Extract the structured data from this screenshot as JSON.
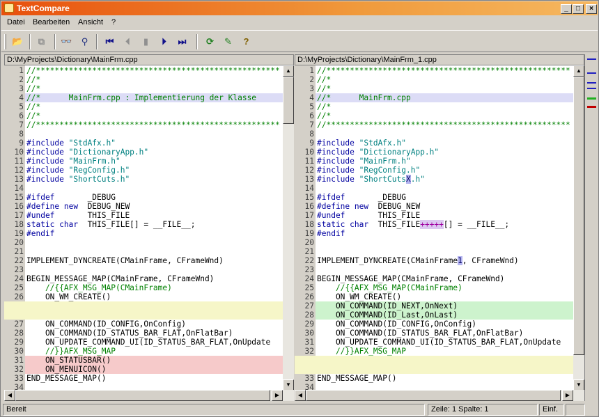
{
  "window": {
    "title": "TextCompare",
    "minimize_label": "_",
    "maximize_label": "□",
    "close_label": "×"
  },
  "menu": [
    {
      "label": "Datei"
    },
    {
      "label": "Bearbeiten"
    },
    {
      "label": "Ansicht"
    },
    {
      "label": "?"
    }
  ],
  "toolbar": [
    {
      "name": "open-folder-icon",
      "glyph": "📂"
    },
    {
      "name": "copy-icon",
      "glyph": "⧉"
    },
    {
      "name": "binoculars-icon",
      "glyph": "👓"
    },
    {
      "name": "find-next-icon",
      "glyph": "⚲"
    },
    {
      "name": "first-diff-icon",
      "glyph": "⏮"
    },
    {
      "name": "prev-diff-icon",
      "glyph": "⏴"
    },
    {
      "name": "current-diff-icon",
      "glyph": "▮"
    },
    {
      "name": "next-diff-icon",
      "glyph": "⏵"
    },
    {
      "name": "last-diff-icon",
      "glyph": "⏭"
    },
    {
      "name": "refresh-icon",
      "glyph": "⟳"
    },
    {
      "name": "options-icon",
      "glyph": "✎"
    },
    {
      "name": "help-icon",
      "glyph": "?"
    }
  ],
  "left": {
    "path": "D:\\MyProjects\\Dictionary\\MainFrm.cpp",
    "lines": [
      {
        "n": "1",
        "t": "//****************************************************",
        "c": "cm"
      },
      {
        "n": "2",
        "t": "//*",
        "c": "cm"
      },
      {
        "n": "3",
        "t": "//*",
        "c": "cm"
      },
      {
        "n": "4",
        "t": "//*      MainFrm.cpp : Implementierung der Klasse",
        "c": "cm",
        "hl": "mod"
      },
      {
        "n": "5",
        "t": "//*",
        "c": "cm"
      },
      {
        "n": "6",
        "t": "//*",
        "c": "cm"
      },
      {
        "n": "7",
        "t": "//****************************************************",
        "c": "cm"
      },
      {
        "n": "8",
        "t": "",
        "c": "def"
      },
      {
        "n": "9",
        "t": "#include \"StdAfx.h\"",
        "c": "inc"
      },
      {
        "n": "10",
        "t": "#include \"DictionaryApp.h\"",
        "c": "inc"
      },
      {
        "n": "11",
        "t": "#include \"MainFrm.h\"",
        "c": "inc"
      },
      {
        "n": "12",
        "t": "#include \"RegConfig.h\"",
        "c": "inc"
      },
      {
        "n": "13",
        "t": "#include \"ShortCuts.h\"",
        "c": "inc"
      },
      {
        "n": "14",
        "t": "",
        "c": "def"
      },
      {
        "n": "15",
        "t": "#ifdef       _DEBUG",
        "c": "pp",
        "kw": "#ifdef",
        "rest": "       _DEBUG"
      },
      {
        "n": "16",
        "t": "#define new  DEBUG_NEW",
        "c": "pp",
        "kw": "#define new",
        "rest": "  DEBUG_NEW"
      },
      {
        "n": "17",
        "t": "#undef       THIS_FILE",
        "c": "pp",
        "kw": "#undef",
        "rest": "       THIS_FILE"
      },
      {
        "n": "18",
        "t": "static char  THIS_FILE[] = __FILE__;",
        "c": "pp",
        "kw": "static char",
        "rest": "  THIS_FILE[] = __FILE__;"
      },
      {
        "n": "19",
        "t": "#endif",
        "c": "kw"
      },
      {
        "n": "20",
        "t": "",
        "c": "def"
      },
      {
        "n": "21",
        "t": "",
        "c": "def"
      },
      {
        "n": "22",
        "t": "IMPLEMENT_DYNCREATE(CMainFrame, CFrameWnd)",
        "c": "def"
      },
      {
        "n": "23",
        "t": "",
        "c": "def"
      },
      {
        "n": "24",
        "t": "BEGIN_MESSAGE_MAP(CMainFrame, CFrameWnd)",
        "c": "def"
      },
      {
        "n": "25",
        "t": "    //{{AFX_MSG_MAP(CMainFrame)",
        "c": "cm"
      },
      {
        "n": "26",
        "t": "    ON_WM_CREATE()",
        "c": "def"
      },
      {
        "n": "",
        "t": "",
        "c": "def",
        "hl": "empty"
      },
      {
        "n": "",
        "t": "",
        "c": "def",
        "hl": "empty"
      },
      {
        "n": "27",
        "t": "    ON_COMMAND(ID_CONFIG,OnConfig)",
        "c": "def"
      },
      {
        "n": "28",
        "t": "    ON_COMMAND(ID_STATUS_BAR_FLAT,OnFlatBar)",
        "c": "def"
      },
      {
        "n": "29",
        "t": "    ON_UPDATE_COMMAND_UI(ID_STATUS_BAR_FLAT,OnUpdate",
        "c": "def"
      },
      {
        "n": "30",
        "t": "    //}}AFX_MSG_MAP",
        "c": "cm"
      },
      {
        "n": "31",
        "t": "    ON_STATUSBAR()",
        "c": "def",
        "hl": "del"
      },
      {
        "n": "32",
        "t": "    ON_MENUICON()",
        "c": "def",
        "hl": "del"
      },
      {
        "n": "33",
        "t": "END_MESSAGE_MAP()",
        "c": "def"
      },
      {
        "n": "34",
        "t": "",
        "c": "def"
      }
    ]
  },
  "right": {
    "path": "D:\\MyProjects\\Dictionary\\MainFrm_1.cpp",
    "lines": [
      {
        "n": "1",
        "t": "//****************************************************",
        "c": "cm"
      },
      {
        "n": "2",
        "t": "//*",
        "c": "cm"
      },
      {
        "n": "3",
        "t": "//*",
        "c": "cm"
      },
      {
        "n": "4",
        "t": "//*      MainFrm.cpp",
        "c": "cm",
        "hl": "mod"
      },
      {
        "n": "5",
        "t": "//*",
        "c": "cm"
      },
      {
        "n": "6",
        "t": "//*",
        "c": "cm"
      },
      {
        "n": "7",
        "t": "//****************************************************",
        "c": "cm"
      },
      {
        "n": "8",
        "t": "",
        "c": "def"
      },
      {
        "n": "9",
        "t": "#include \"StdAfx.h\"",
        "c": "inc"
      },
      {
        "n": "10",
        "t": "#include \"DictionaryApp.h\"",
        "c": "inc"
      },
      {
        "n": "11",
        "t": "#include \"MainFrm.h\"",
        "c": "inc"
      },
      {
        "n": "12",
        "t": "#include \"RegConfig.h\"",
        "c": "inc"
      },
      {
        "n": "13",
        "t": "#include \"ShortCutsX.h\"",
        "c": "inc",
        "mark": {
          "pre": "#include \"ShortCuts",
          "m": "X",
          "post": ".h\"",
          "cls": "blue"
        }
      },
      {
        "n": "14",
        "t": "",
        "c": "def"
      },
      {
        "n": "15",
        "t": "#ifdef       _DEBUG",
        "c": "pp",
        "kw": "#ifdef",
        "rest": "       _DEBUG"
      },
      {
        "n": "16",
        "t": "#define new  DEBUG_NEW",
        "c": "pp",
        "kw": "#define new",
        "rest": "  DEBUG_NEW"
      },
      {
        "n": "17",
        "t": "#undef       THIS_FILE",
        "c": "pp",
        "kw": "#undef",
        "rest": "       THIS_FILE"
      },
      {
        "n": "18",
        "t": "static char  THIS_FILE+++++[] = __FILE__;",
        "c": "pp",
        "kw": "static char",
        "rest": "  THIS_FILE",
        "mark": {
          "m": "+++++",
          "post": "[] = __FILE__;",
          "cls": "purple"
        }
      },
      {
        "n": "19",
        "t": "#endif",
        "c": "kw"
      },
      {
        "n": "20",
        "t": "",
        "c": "def"
      },
      {
        "n": "21",
        "t": "",
        "c": "def"
      },
      {
        "n": "22",
        "t": "IMPLEMENT_DYNCREATE(CMainFrame1, CFrameWnd)",
        "c": "def",
        "mark": {
          "pre": "IMPLEMENT_DYNCREATE(CMainFrame",
          "m": "1",
          "post": ", CFrameWnd)",
          "cls": "blue"
        }
      },
      {
        "n": "23",
        "t": "",
        "c": "def"
      },
      {
        "n": "24",
        "t": "BEGIN_MESSAGE_MAP(CMainFrame, CFrameWnd)",
        "c": "def"
      },
      {
        "n": "25",
        "t": "    //{{AFX_MSG_MAP(CMainFrame)",
        "c": "cm"
      },
      {
        "n": "26",
        "t": "    ON_WM_CREATE()",
        "c": "def"
      },
      {
        "n": "27",
        "t": "    ON_COMMAND(ID_NEXT,OnNext)",
        "c": "def",
        "hl": "add"
      },
      {
        "n": "28",
        "t": "    ON_COMMAND(ID_Last,OnLast)",
        "c": "def",
        "hl": "add"
      },
      {
        "n": "29",
        "t": "    ON_COMMAND(ID_CONFIG,OnConfig)",
        "c": "def"
      },
      {
        "n": "30",
        "t": "    ON_COMMAND(ID_STATUS_BAR_FLAT,OnFlatBar)",
        "c": "def"
      },
      {
        "n": "31",
        "t": "    ON_UPDATE_COMMAND_UI(ID_STATUS_BAR_FLAT,OnUpdate",
        "c": "def"
      },
      {
        "n": "32",
        "t": "    //}}AFX_MSG_MAP",
        "c": "cm"
      },
      {
        "n": "",
        "t": "",
        "c": "def",
        "hl": "empty"
      },
      {
        "n": "",
        "t": "",
        "c": "def",
        "hl": "empty"
      },
      {
        "n": "33",
        "t": "END_MESSAGE_MAP()",
        "c": "def"
      },
      {
        "n": "34",
        "t": "",
        "c": "def"
      }
    ]
  },
  "status": {
    "text": "Bereit",
    "position": "Zeile: 1  Spalte: 1",
    "mode": "Einf."
  },
  "colors": {
    "modified": "#dcdcf6",
    "added": "#cdf3cd",
    "deleted": "#f6caca",
    "placeholder": "#f6f6c8"
  }
}
